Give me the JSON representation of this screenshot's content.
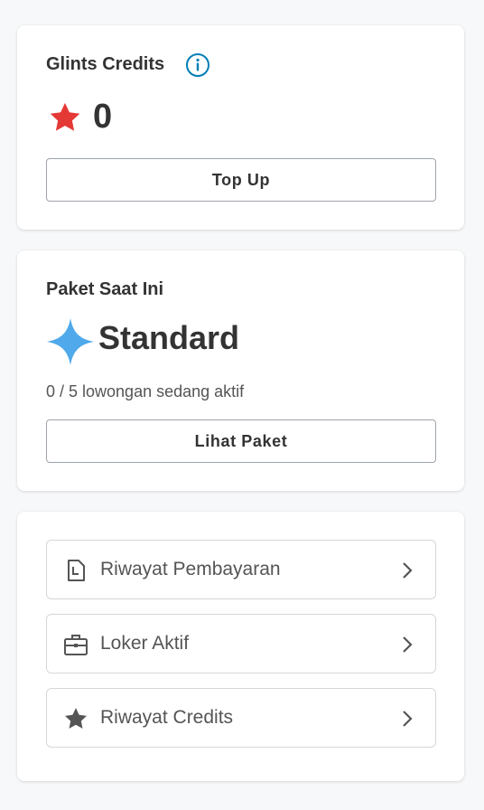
{
  "credits": {
    "title": "Glints Credits",
    "info_icon": "info-icon",
    "star_icon": "star-icon",
    "star_color": "#e53935",
    "value": "0",
    "top_up_label": "Top Up"
  },
  "package": {
    "title": "Paket Saat Ini",
    "plan_icon": "sparkle-icon",
    "plan_color": "#4fa9ea",
    "plan_name": "Standard",
    "status": "0 / 5 lowongan sedang aktif",
    "view_label": "Lihat Paket"
  },
  "links": [
    {
      "label": "Riwayat Pembayaran",
      "icon": "receipt-icon"
    },
    {
      "label": "Loker Aktif",
      "icon": "briefcase-icon"
    },
    {
      "label": "Riwayat Credits",
      "icon": "star-icon"
    }
  ],
  "colors": {
    "accent": "#017eb7",
    "text": "#333333",
    "border": "#d4d7da"
  }
}
